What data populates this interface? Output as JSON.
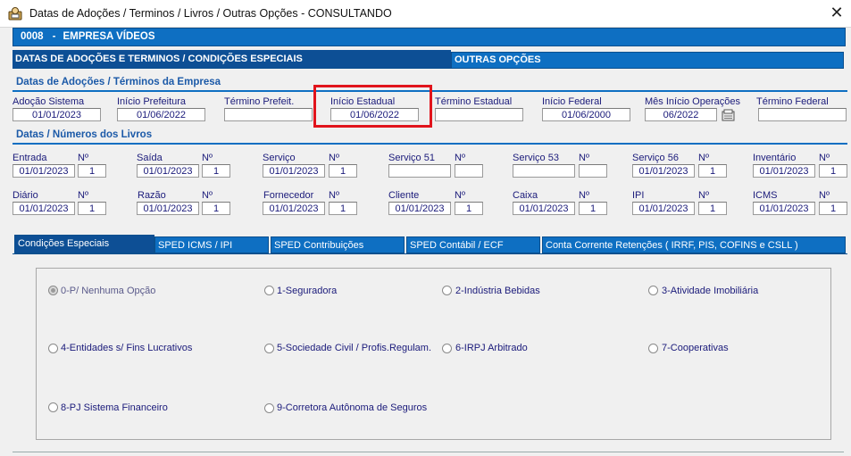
{
  "window": {
    "title": "Datas de Adoções / Terminos / Livros / Outras Opções - CONSULTANDO",
    "close_glyph": "✕"
  },
  "company": {
    "code": "0008",
    "separator": "-",
    "name": "EMPRESA VÍDEOS"
  },
  "tabs_top": [
    {
      "label": "DATAS DE ADOÇÕES E TERMINOS / CONDIÇÕES ESPECIAIS"
    },
    {
      "label": "OUTRAS OPÇÕES"
    }
  ],
  "sections": {
    "adocoes": "Datas de Adoções / Términos da Empresa",
    "livros": "Datas / Números dos Livros"
  },
  "adocoes": [
    {
      "label": "Adoção Sistema",
      "value": "01/01/2023"
    },
    {
      "label": "Início Prefeitura",
      "value": "01/06/2022"
    },
    {
      "label": "Término Prefeit.",
      "value": ""
    },
    {
      "label": "Início Estadual",
      "value": "01/06/2022"
    },
    {
      "label": "Término Estadual",
      "value": ""
    },
    {
      "label": "Início Federal",
      "value": "01/06/2000"
    },
    {
      "label": "Mês Início Operações",
      "value": "06/2022"
    },
    {
      "label": "Término Federal",
      "value": ""
    }
  ],
  "livros_row1": [
    {
      "label": "Entrada",
      "date": "01/01/2023",
      "num": "1"
    },
    {
      "label": "Saída",
      "date": "01/01/2023",
      "num": "1"
    },
    {
      "label": "Serviço",
      "date": "01/01/2023",
      "num": "1"
    },
    {
      "label": "Serviço 51",
      "date": "",
      "num": ""
    },
    {
      "label": "Serviço 53",
      "date": "",
      "num": ""
    },
    {
      "label": "Serviço 56",
      "date": "01/01/2023",
      "num": "1"
    },
    {
      "label": "Inventário",
      "date": "01/01/2023",
      "num": "1"
    }
  ],
  "livros_row2": [
    {
      "label": "Diário",
      "date": "01/01/2023",
      "num": "1"
    },
    {
      "label": "Razão",
      "date": "01/01/2023",
      "num": "1"
    },
    {
      "label": "Fornecedor",
      "date": "01/01/2023",
      "num": "1"
    },
    {
      "label": "Cliente",
      "date": "01/01/2023",
      "num": "1"
    },
    {
      "label": "Caixa",
      "date": "01/01/2023",
      "num": "1"
    },
    {
      "label": "IPI",
      "date": "01/01/2023",
      "num": "1"
    },
    {
      "label": "ICMS",
      "date": "01/01/2023",
      "num": "1"
    }
  ],
  "num_label": "Nº",
  "tabs_bottom": [
    {
      "label": "Condições Especiais"
    },
    {
      "label": "SPED ICMS / IPI"
    },
    {
      "label": "SPED Contribuições"
    },
    {
      "label": "SPED Contábil / ECF"
    },
    {
      "label": "Conta Corrente Retenções ( IRRF, PIS, COFINS  e  CSLL )"
    }
  ],
  "options": [
    {
      "label": "0-P/ Nenhuma Opção",
      "selected": true
    },
    {
      "label": "1-Seguradora",
      "selected": false
    },
    {
      "label": "2-Indústria Bebidas",
      "selected": false
    },
    {
      "label": "3-Atividade Imobiliária",
      "selected": false
    },
    {
      "label": "4-Entidades s/ Fins Lucrativos",
      "selected": false
    },
    {
      "label": "5-Sociedade Civil / Profis.Regulam.",
      "selected": false
    },
    {
      "label": "6-IRPJ Arbitrado",
      "selected": false
    },
    {
      "label": "7-Cooperativas",
      "selected": false
    },
    {
      "label": "8-PJ Sistema Financeiro",
      "selected": false
    },
    {
      "label": "9-Corretora Autônoma de Seguros",
      "selected": false
    }
  ],
  "colors": {
    "tab_blue": "#0e6fc2",
    "tab_active": "#0d4f95",
    "text": "#1a1a7a",
    "highlight": "#e1141c"
  },
  "icons": {
    "app": "app-icon",
    "calendar": "calculator-icon"
  }
}
